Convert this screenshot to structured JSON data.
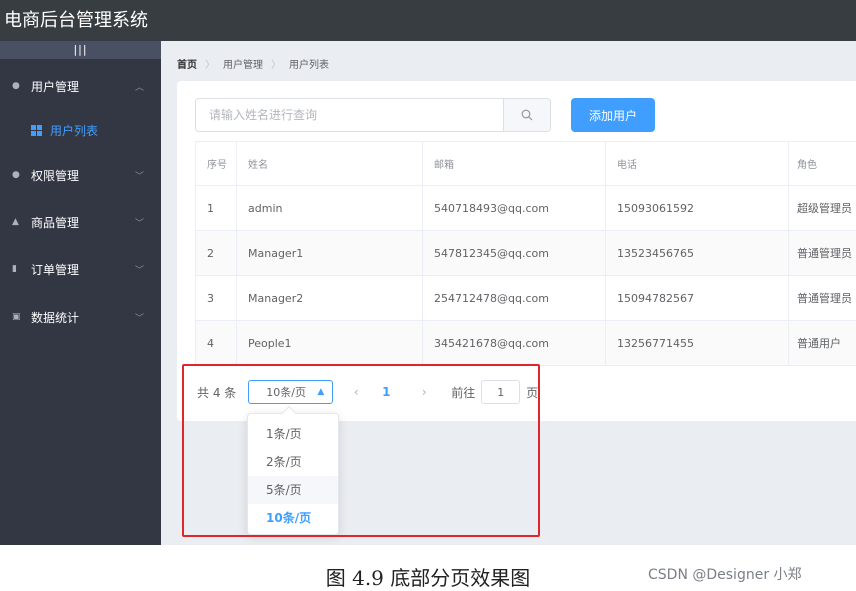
{
  "app": {
    "title": "电商后台管理系统"
  },
  "sidebar": {
    "toggle_label": "|||",
    "menus": [
      {
        "label": "用户管理",
        "icon": "user-icon",
        "arrow": "︿"
      },
      {
        "label": "权限管理",
        "icon": "permission-icon",
        "arrow": "﹀"
      },
      {
        "label": "商品管理",
        "icon": "goods-icon",
        "arrow": "﹀"
      },
      {
        "label": "订单管理",
        "icon": "order-icon",
        "arrow": "﹀"
      },
      {
        "label": "数据统计",
        "icon": "stats-icon",
        "arrow": "﹀"
      }
    ],
    "active_sub": {
      "label": "用户列表",
      "icon": "grid-icon"
    }
  },
  "breadcrumb": {
    "home": "首页",
    "level1": "用户管理",
    "level2": "用户列表",
    "separator": "〉"
  },
  "search": {
    "placeholder": "请输入姓名进行查询",
    "value": ""
  },
  "toolbar": {
    "add_label": "添加用户"
  },
  "table": {
    "headers": [
      "序号",
      "姓名",
      "邮箱",
      "电话",
      "角色"
    ],
    "rows": [
      [
        "1",
        "admin",
        "540718493@qq.com",
        "15093061592",
        "超级管理员"
      ],
      [
        "2",
        "Manager1",
        "547812345@qq.com",
        "13523456765",
        "普通管理员"
      ],
      [
        "3",
        "Manager2",
        "254712478@qq.com",
        "15094782567",
        "普通管理员"
      ],
      [
        "4",
        "People1",
        "345421678@qq.com",
        "13256771455",
        "普通用户"
      ]
    ]
  },
  "pagination": {
    "total_text": "共 4 条",
    "page_size": "10条/页",
    "current_page": "1",
    "goto_label": "前往",
    "goto_value": "1",
    "page_unit": "页",
    "options": [
      "1条/页",
      "2条/页",
      "5条/页",
      "10条/页"
    ]
  },
  "caption": "图 4.9  底部分页效果图",
  "watermark": "CSDN @Designer 小郑",
  "colors": {
    "primary": "#409eff",
    "sidebar": "#333744",
    "topbar": "#373d41",
    "highlight": "#e0262b"
  }
}
